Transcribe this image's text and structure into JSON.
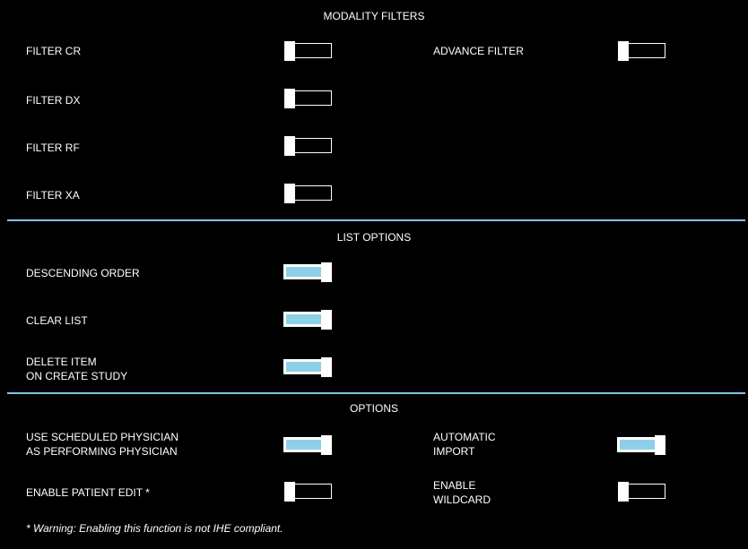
{
  "sections": {
    "modality_filters": {
      "title": "MODALITY FILTERS",
      "items": [
        {
          "label": "FILTER CR",
          "on": false
        },
        {
          "label": "FILTER DX",
          "on": false
        },
        {
          "label": "FILTER RF",
          "on": false
        },
        {
          "label": "FILTER XA",
          "on": false
        }
      ],
      "advance_filter": {
        "label": "ADVANCE FILTER",
        "on": false
      }
    },
    "list_options": {
      "title": "LIST OPTIONS",
      "items": [
        {
          "label": "DESCENDING ORDER",
          "on": true
        },
        {
          "label": "CLEAR LIST",
          "on": true
        },
        {
          "label_line1": "DELETE ITEM",
          "label_line2": "ON CREATE STUDY",
          "on": true
        }
      ]
    },
    "options": {
      "title": "OPTIONS",
      "use_scheduled": {
        "label_line1": "USE SCHEDULED PHYSICIAN",
        "label_line2": "AS PERFORMING PHYSICIAN",
        "on": true
      },
      "enable_patient_edit": {
        "label": "ENABLE PATIENT EDIT *",
        "on": false
      },
      "automatic_import": {
        "label_line1": "AUTOMATIC",
        "label_line2": "IMPORT",
        "on": true
      },
      "enable_wildcard": {
        "label_line1": "ENABLE",
        "label_line2": "WILDCARD",
        "on": false
      },
      "warning": "* Warning: Enabling this function is not IHE compliant."
    }
  },
  "colors": {
    "background": "#000000",
    "text": "#ffffff",
    "divider": "#7fc6e4",
    "toggle_on_fill": "#8dd0e8"
  }
}
